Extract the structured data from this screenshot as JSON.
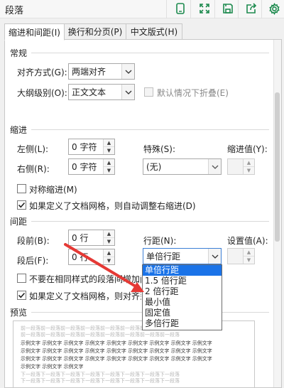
{
  "window": {
    "title": "段落"
  },
  "toolbar": {
    "icons": [
      "phone-icon",
      "expand-icon",
      "save-icon",
      "share-icon",
      "gear-icon"
    ]
  },
  "tabs": [
    "缩进和间距(I)",
    "换行和分页(P)",
    "中文版式(H)"
  ],
  "general": {
    "header": "常规",
    "alignment_label": "对齐方式(G):",
    "alignment_value": "两端对齐",
    "outline_label": "大纲级别(O):",
    "outline_value": "正文文本",
    "collapse_label": "默认情况下折叠(E)"
  },
  "indent": {
    "header": "缩进",
    "left_label": "左侧(L):",
    "left_value": "0 字符",
    "right_label": "右侧(R):",
    "right_value": "0 字符",
    "special_label": "特殊(S):",
    "special_value": "(无)",
    "indent_value_label": "缩进值(Y):",
    "indent_value": "",
    "mirror_label": "对称缩进(M)",
    "auto_adjust_label": "如果定义了文档网格，则自动调整右缩进(D)"
  },
  "spacing": {
    "header": "间距",
    "before_label": "段前(B):",
    "before_value": "0 行",
    "after_label": "段后(F):",
    "after_value": "0 行",
    "line_spacing_label": "行距(N):",
    "line_spacing_value": "单倍行距",
    "set_value_label": "设置值(A):",
    "set_value": "",
    "no_space_label": "不要在相同样式的段落间增加间距",
    "snap_grid_label": "如果定义了文档网格，则对齐到网格"
  },
  "line_spacing_options": [
    "单倍行距",
    "1.5 倍行距",
    "2 倍行距",
    "最小值",
    "固定值",
    "多倍行距"
  ],
  "line_spacing_selected": 0,
  "preview": {
    "header": "预览",
    "before_text": "前一段落前一段落前一段落前一段落前一段落前一段落前一段落前一段落",
    "sample_text": "示例文字 示例文字 示例文字 示例文字 示例文字 示例文字 示例文字 示例文字 示例文字",
    "sample_short": "示例文字 示例文字 示例文字",
    "after_text": "下一段落下一段落下一段落下一段落下一段落下一段落下一段落下一段落"
  },
  "colors": {
    "accent": "#1a73e8",
    "arrow": "#e53935",
    "icon": "#1d8a4e"
  }
}
